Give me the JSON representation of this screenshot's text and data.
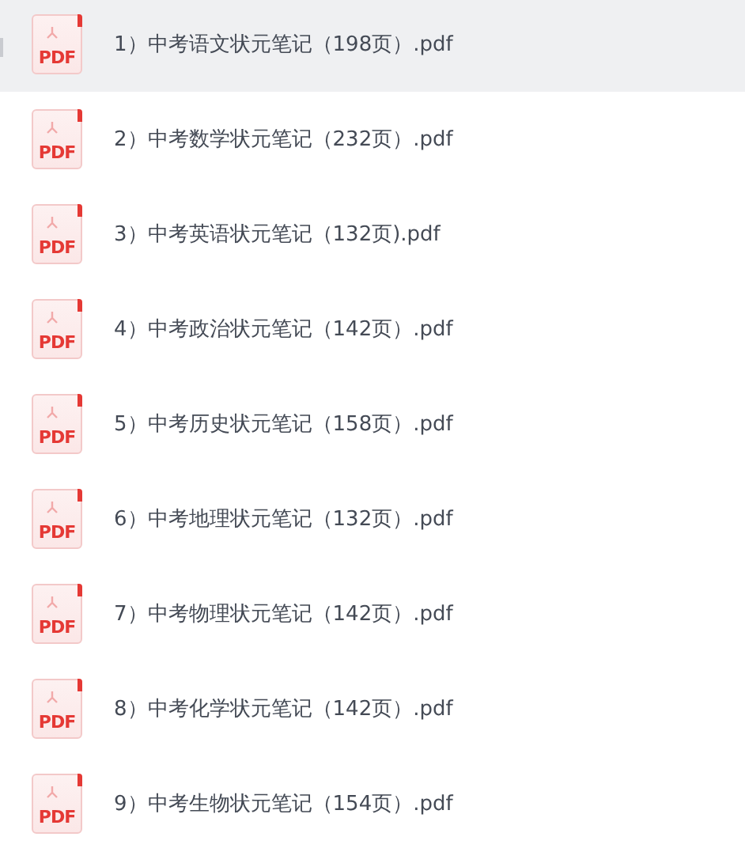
{
  "files": [
    {
      "name": "1）中考语文状元笔记（198页）.pdf",
      "badge": "PDF",
      "selected": true
    },
    {
      "name": "2）中考数学状元笔记（232页）.pdf",
      "badge": "PDF",
      "selected": false
    },
    {
      "name": "3）中考英语状元笔记（132页).pdf",
      "badge": "PDF",
      "selected": false
    },
    {
      "name": "4）中考政治状元笔记（142页）.pdf",
      "badge": "PDF",
      "selected": false
    },
    {
      "name": "5）中考历史状元笔记（158页）.pdf",
      "badge": "PDF",
      "selected": false
    },
    {
      "name": "6）中考地理状元笔记（132页）.pdf",
      "badge": "PDF",
      "selected": false
    },
    {
      "name": "7）中考物理状元笔记（142页）.pdf",
      "badge": "PDF",
      "selected": false
    },
    {
      "name": "8）中考化学状元笔记（142页）.pdf",
      "badge": "PDF",
      "selected": false
    },
    {
      "name": "9）中考生物状元笔记（154页）.pdf",
      "badge": "PDF",
      "selected": false
    }
  ]
}
